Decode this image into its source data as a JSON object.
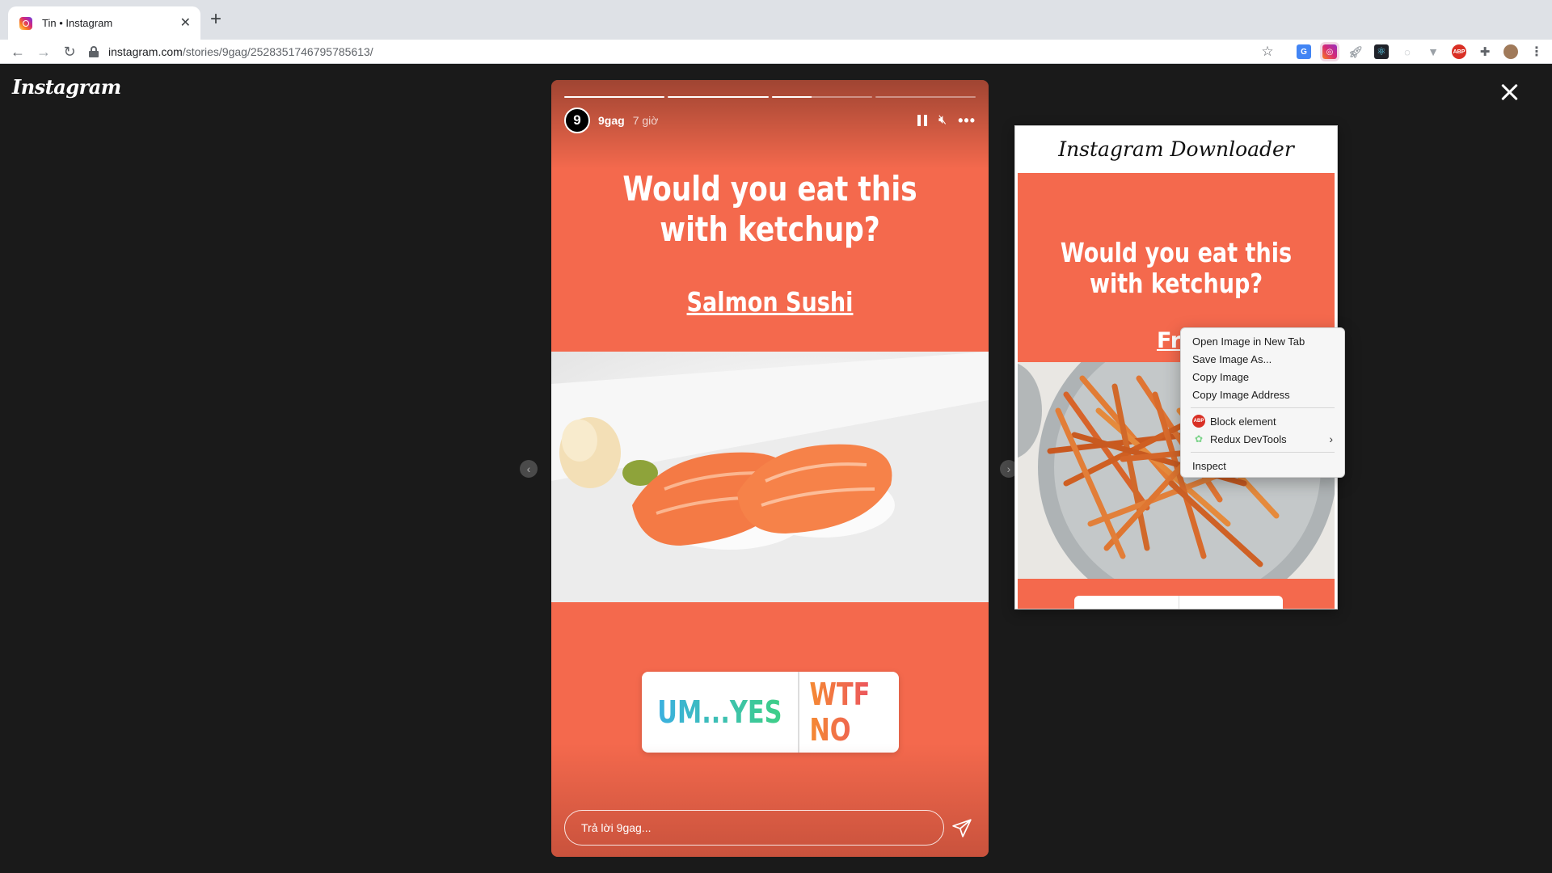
{
  "browser": {
    "tab_title": "Tin • Instagram",
    "url_domain": "instagram.com",
    "url_path": "/stories/9gag/2528351746795785613/"
  },
  "page": {
    "logo": "Instagram"
  },
  "story": {
    "username": "9gag",
    "avatar_letter": "9",
    "time": "7 giờ",
    "question": "Would you eat this with ketchup?",
    "subtitle": "Salmon Sushi",
    "poll_yes": "UM...YES",
    "poll_no": "WTF NO",
    "reply_placeholder": "Trả lời 9gag...",
    "progress": [
      1.0,
      1.0,
      0.4,
      0.0
    ],
    "bg_color": "#f4694d"
  },
  "downloader": {
    "title": "Instagram Downloader",
    "question": "Would you eat this with ketchup?",
    "subtitle": "Fri"
  },
  "context_menu": {
    "items": [
      {
        "label": "Open Image in New Tab"
      },
      {
        "label": "Save Image As..."
      },
      {
        "label": "Copy Image"
      },
      {
        "label": "Copy Image Address"
      },
      {
        "label": "Block element",
        "icon": "adblock-icon"
      },
      {
        "label": "Redux DevTools",
        "icon": "redux-icon",
        "submenu": true
      },
      {
        "label": "Inspect"
      }
    ]
  },
  "extensions": [
    "translate-icon",
    "instagram-downloader-icon",
    "rocket-icon",
    "react-devtools-icon",
    "clock-icon",
    "vue-devtools-icon",
    "adblock-icon",
    "puzzle-icon",
    "profile-avatar"
  ]
}
